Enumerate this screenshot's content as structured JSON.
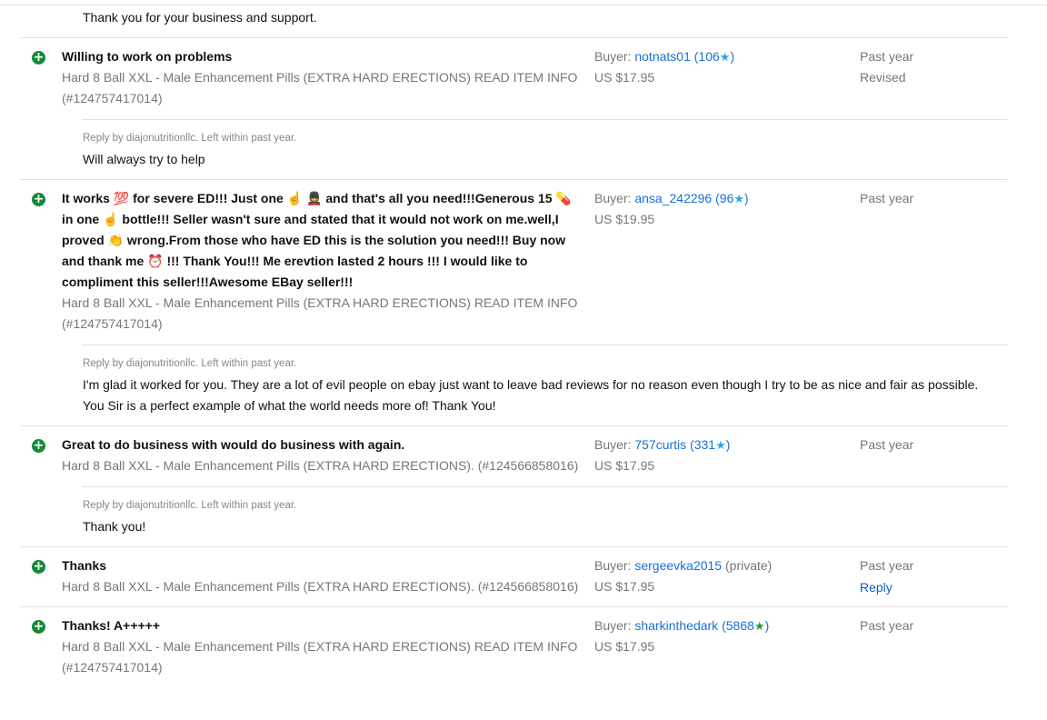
{
  "top_reply": "Thank you for your business and support.",
  "entries": [
    {
      "icon": "positive-plus-icon",
      "comment": "Willing to work on problems",
      "item_line1": "Hard 8 Ball XXL - Male Enhancement Pills (EXTRA HARD ERECTIONS) READ ITEM INFO",
      "item_line2": "(#124757417014)",
      "buyer_label": "Buyer:",
      "buyer_name": "notnats01",
      "buyer_score": "106",
      "price": "US $17.95",
      "time": "Past year",
      "status": "Revised",
      "reply_meta": "Reply by diajonutritionllc. Left within past year.",
      "reply_text": "Will always try to help"
    },
    {
      "icon": "positive-plus-icon",
      "comment_lines": [
        "It works 💯 for severe ED!!! Just one ☝ 💂 and that's all you need!!!Generous 15 💊",
        "in one ☝ bottle!!! Seller wasn't sure and stated that it would not work on me.well,I",
        "proved 👏 wrong.From those who have ED this is the solution you need!!! Buy now",
        "and thank me ⏰ !!! Thank You!!! Me erevtion lasted 2 hours !!! I would like to",
        "compliment this seller!!!Awesome EBay seller!!!"
      ],
      "item_line1": "Hard 8 Ball XXL - Male Enhancement Pills (EXTRA HARD ERECTIONS) READ ITEM INFO",
      "item_line2": "(#124757417014)",
      "buyer_label": "Buyer:",
      "buyer_name": "ansa_242296",
      "buyer_score": "96",
      "price": "US $19.95",
      "time": "Past year",
      "reply_meta": "Reply by diajonutritionllc. Left within past year.",
      "reply_line1": "I'm glad it worked for you. They are a lot of evil people on ebay just want to leave bad reviews for no reason even though I try to be as nice and fair as possible.",
      "reply_line2": "You Sir is a perfect example of what the world needs more of! Thank You!"
    },
    {
      "icon": "positive-plus-icon",
      "comment": "Great to do business with would do business with again.",
      "item_line1": "Hard 8 Ball XXL - Male Enhancement Pills (EXTRA HARD ERECTIONS). (#124566858016)",
      "buyer_label": "Buyer:",
      "buyer_name": "757curtis",
      "buyer_score": "331",
      "price": "US $17.95",
      "time": "Past year",
      "reply_meta": "Reply by diajonutritionllc. Left within past year.",
      "reply_text": "Thank you!"
    },
    {
      "icon": "positive-plus-icon",
      "comment": "Thanks",
      "item_line1": "Hard 8 Ball XXL - Male Enhancement Pills (EXTRA HARD ERECTIONS). (#124566858016)",
      "buyer_label": "Buyer:",
      "buyer_name": "sergeevka2015",
      "buyer_private": "(private)",
      "price": "US $17.95",
      "time": "Past year",
      "reply_link": "Reply"
    },
    {
      "icon": "positive-plus-icon",
      "comment": "Thanks! A+++++",
      "item_line1": "Hard 8 Ball XXL - Male Enhancement Pills (EXTRA HARD ERECTIONS) READ ITEM INFO",
      "item_line2": "(#124757417014)",
      "buyer_label": "Buyer:",
      "buyer_name": "sharkinthedark",
      "buyer_score": "5868",
      "price": "US $17.95",
      "time": "Past year"
    }
  ],
  "star_colors": {
    "default": "#27a7e8",
    "high_score": "#1c9b3d"
  },
  "positive_color": "#138a36"
}
